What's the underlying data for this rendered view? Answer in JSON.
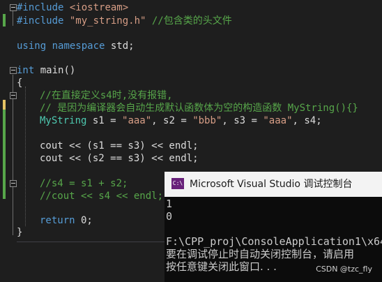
{
  "editor": {
    "lines": {
      "l1": {
        "kw": "#include",
        "rest": " <iostream>"
      },
      "l2": {
        "kw": "#include",
        "str": " \"my_string.h\"",
        "cmt": " //包含类的头文件"
      },
      "l4": {
        "kw1": "using",
        "kw2": " namespace",
        "rest": " std;"
      },
      "l6": {
        "kw": "int",
        "rest": " main()"
      },
      "l7": {
        "rest": "{"
      },
      "l8": {
        "cmt": "//在直接定义s4时,没有报错,"
      },
      "l9": {
        "cmt": "// 是因为编译器会自动生成默认函数体为空的构造函数 MyString(){}"
      },
      "l10": {
        "type": "MyString",
        "p1": " s1 = ",
        "s1": "\"aaa\"",
        "p2": ", s2 = ",
        "s2": "\"bbb\"",
        "p3": ", s3 = ",
        "s3": "\"aaa\"",
        "p4": ", s4;"
      },
      "l12": {
        "rest": "cout << (s1 == s3) << endl;"
      },
      "l13": {
        "rest": "cout << (s2 == s3) << endl;"
      },
      "l15": {
        "cmt": "//s4 = s1 + s2;"
      },
      "l16": {
        "cmt": "//cout << s4 << endl;"
      },
      "l18": {
        "kw": "return",
        "rest": " 0;"
      },
      "l19": {
        "rest": "}"
      }
    }
  },
  "console": {
    "icon_text": "C:\\",
    "title": "Microsoft Visual Studio 调试控制台",
    "output": [
      "1",
      "0",
      "",
      "F:\\CPP_proj\\ConsoleApplication1\\x64",
      "要在调试停止时自动关闭控制台，请启用",
      "按任意键关闭此窗口. . ."
    ]
  },
  "watermark": "CSDN @tzc_fly",
  "colors": {
    "keyword": "#569cd6",
    "string": "#d69d85",
    "comment": "#57a64a",
    "type": "#4ec9b0",
    "change_bar_saved": "#57a64a",
    "change_bar_unsaved": "#e5c365"
  }
}
